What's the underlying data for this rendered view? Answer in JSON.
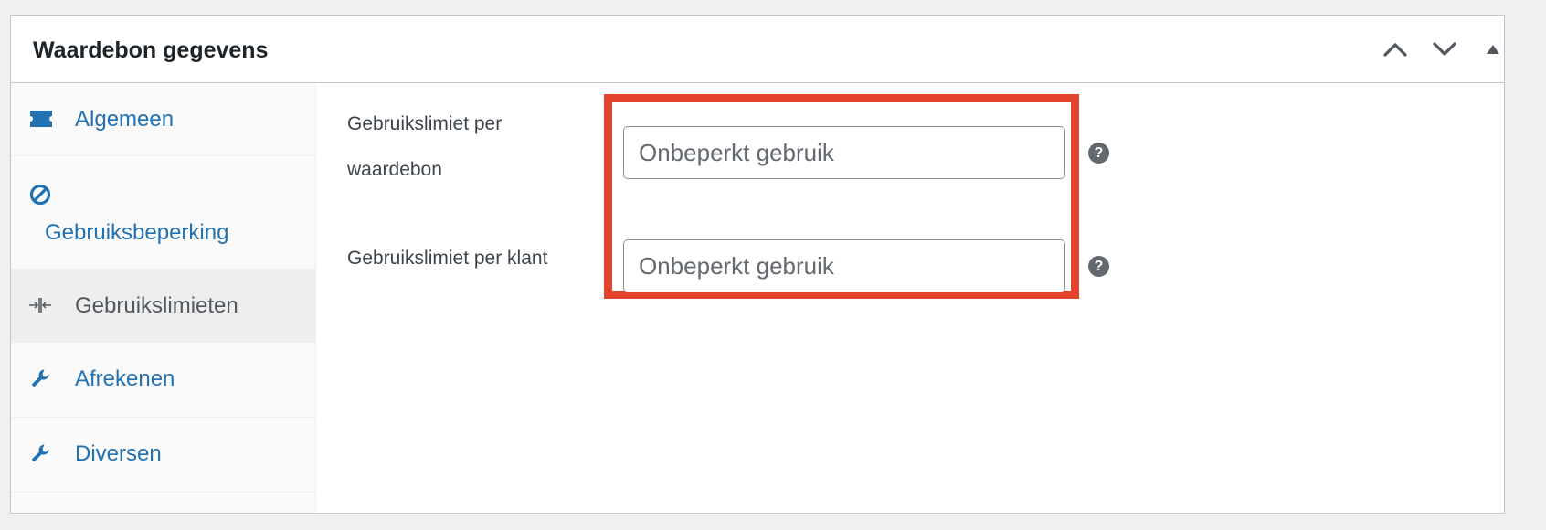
{
  "panel": {
    "title": "Waardebon gegevens",
    "controls": {
      "move_up_icon": "chevron-up-icon",
      "move_down_icon": "chevron-down-icon",
      "toggle_icon": "triangle-up-icon"
    }
  },
  "tabs": [
    {
      "label": "Algemeen",
      "icon": "ticket-icon",
      "active": false
    },
    {
      "label": "Gebruiksbeperking",
      "icon": "block-icon",
      "active": false
    },
    {
      "label": "Gebruikslimieten",
      "icon": "collapse-arrows-icon",
      "active": true
    },
    {
      "label": "Afrekenen",
      "icon": "wrench-icon",
      "active": false
    },
    {
      "label": "Diversen",
      "icon": "wrench-icon",
      "active": false
    }
  ],
  "fields": {
    "usage_limit_per_coupon": {
      "label_line1": "Gebruikslimiet per",
      "label_line2": "waardebon",
      "placeholder": "Onbeperkt gebruik",
      "value": ""
    },
    "usage_limit_per_user": {
      "label": "Gebruikslimiet per klant",
      "placeholder": "Onbeperkt gebruik",
      "value": ""
    },
    "help_glyph": "?"
  },
  "colors": {
    "link": "#2271b1",
    "highlight": "#e2432a",
    "active_tab_bg": "#eeeeee"
  }
}
